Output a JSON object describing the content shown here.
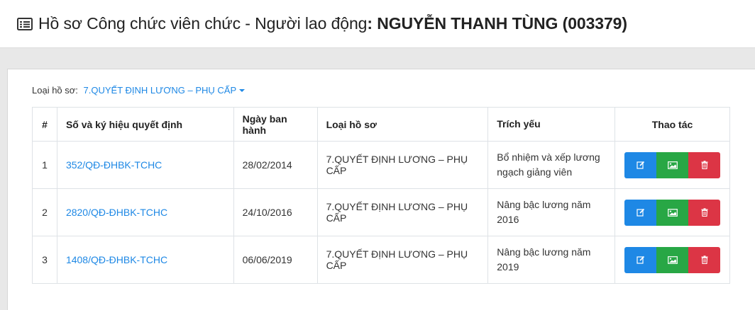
{
  "header": {
    "title_prefix": "Hồ sơ Công chức viên chức - Người lao động",
    "colon": ": ",
    "employee_name": "NGUYỄN THANH TÙNG (003379)"
  },
  "filter": {
    "label": "Loại hồ sơ:",
    "selected": "7.QUYẾT ĐỊNH LƯƠNG – PHỤ CẤP"
  },
  "table": {
    "columns": [
      "#",
      "Số và ký hiệu quyết định",
      "Ngày ban hành",
      "Loại hồ sơ",
      "Trích yếu",
      "Thao tác"
    ],
    "rows": [
      {
        "no": "1",
        "decision": "352/QĐ-ĐHBK-TCHC",
        "date": "28/02/2014",
        "type": "7.QUYẾT ĐỊNH LƯƠNG – PHỤ CẤP",
        "summary": "Bổ nhiệm và xếp lương ngạch giảng viên"
      },
      {
        "no": "2",
        "decision": "2820/QĐ-ĐHBK-TCHC",
        "date": "24/10/2016",
        "type": "7.QUYẾT ĐỊNH LƯƠNG – PHỤ CẤP",
        "summary": "Nâng bậc lương năm 2016"
      },
      {
        "no": "3",
        "decision": "1408/QĐ-ĐHBK-TCHC",
        "date": "06/06/2019",
        "type": "7.QUYẾT ĐỊNH LƯƠNG – PHỤ CẤP",
        "summary": "Nâng bậc lương năm 2019"
      }
    ]
  },
  "icons": {
    "title": "list-alt-icon",
    "edit": "edit-icon",
    "image": "image-icon",
    "delete": "trash-icon"
  },
  "colors": {
    "link": "#1e88e5",
    "edit": "#1e88e5",
    "image": "#28a745",
    "delete": "#dc3545"
  }
}
